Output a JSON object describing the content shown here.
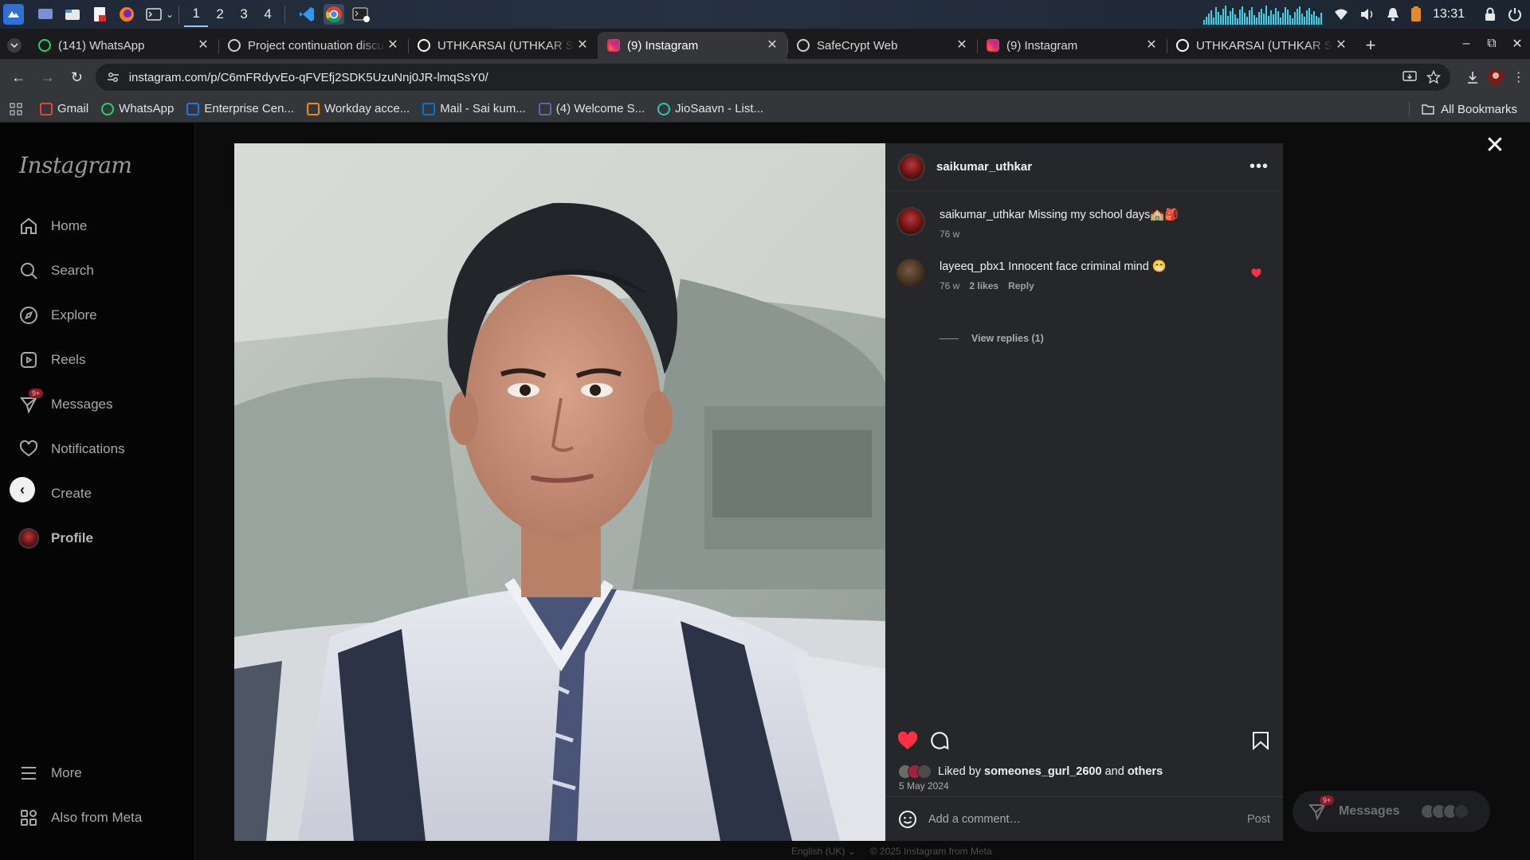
{
  "os_panel": {
    "workspaces": [
      "1",
      "2",
      "3",
      "4"
    ],
    "clock": "13:31"
  },
  "browser": {
    "tabs": [
      {
        "title": "(141) WhatsApp",
        "icon": "whatsapp-icon",
        "color": "#25d366"
      },
      {
        "title": "Project continuation discussion",
        "icon": "chatgpt-icon",
        "color": "#cfcfcf"
      },
      {
        "title": "UTHKARSAI (UTHKAR SAI)",
        "icon": "github-icon",
        "color": "#ffffff"
      },
      {
        "title": "(9) Instagram",
        "icon": "instagram-icon",
        "color": "#e1306c",
        "active": true
      },
      {
        "title": "SafeCrypt Web",
        "icon": "globe-icon",
        "color": "#cfcfcf"
      },
      {
        "title": "(9) Instagram",
        "icon": "instagram-icon",
        "color": "#e1306c"
      },
      {
        "title": "UTHKARSAI (UTHKAR SAI)",
        "icon": "github-icon",
        "color": "#ffffff"
      }
    ],
    "url": "instagram.com/p/C6mFRdyvEo-qFVEfj2SDK5UzuNnj0JR-lmqSsY0/",
    "bookmarks": [
      {
        "label": "Gmail",
        "icon": "gmail-icon",
        "color": "#ea4335"
      },
      {
        "label": "WhatsApp",
        "icon": "whatsapp-icon",
        "color": "#25d366"
      },
      {
        "label": "Enterprise Cen...",
        "icon": "meta-icon",
        "color": "#1877f2"
      },
      {
        "label": "Workday acce...",
        "icon": "workday-icon",
        "color": "#f38b00"
      },
      {
        "label": "Mail - Sai kum...",
        "icon": "outlook-icon",
        "color": "#0078d4"
      },
      {
        "label": "(4) Welcome S...",
        "icon": "teams-icon",
        "color": "#6264a7"
      },
      {
        "label": "JioSaavn - List...",
        "icon": "jiosaavn-icon",
        "color": "#2bc5b4"
      }
    ],
    "all_bookmarks": "All Bookmarks"
  },
  "instagram": {
    "logo": "Instagram",
    "nav": {
      "home": "Home",
      "search": "Search",
      "explore": "Explore",
      "reels": "Reels",
      "messages": "Messages",
      "messages_badge": "9+",
      "notifications": "Notifications",
      "create": "Create",
      "profile": "Profile",
      "more": "More",
      "also_from_meta": "Also from Meta"
    },
    "post": {
      "username": "saikumar_uthkar",
      "caption_user": "saikumar_uthkar",
      "caption_text": "Missing my school days🏫🎒",
      "caption_age": "76 w",
      "comments": [
        {
          "user": "layeeq_pbx1",
          "text": "Innocent face criminal mind 😁",
          "age": "76 w",
          "likes": "2 likes",
          "reply": "Reply"
        }
      ],
      "view_replies": "View replies (1)",
      "liked_by_prefix": "Liked by",
      "liked_by_user": "someones_gurl_2600",
      "liked_by_and": "and",
      "liked_by_others": "others",
      "date": "5 May 2024",
      "add_comment_placeholder": "Add a comment…",
      "post_button": "Post",
      "liked": true,
      "like_color": "#ff3040"
    },
    "messages_float": {
      "label": "Messages",
      "badge": "9+"
    },
    "footer": {
      "language": "English (UK) ⌄",
      "copyright": "© 2025 Instagram from Meta"
    }
  }
}
